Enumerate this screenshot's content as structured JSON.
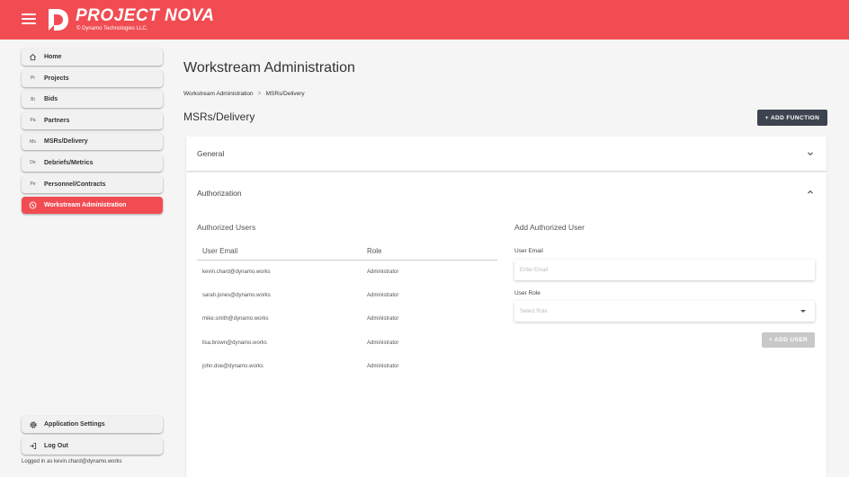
{
  "app": {
    "brand": "PROJECT NOVA",
    "copyright": "© Dynamo Technologies LLC.",
    "accent": "#f14c52"
  },
  "sidebar": {
    "items": [
      {
        "label": "Home",
        "abbr": "",
        "icon": "home-icon"
      },
      {
        "label": "Projects",
        "abbr": "Pr"
      },
      {
        "label": "Bids",
        "abbr": "Bi"
      },
      {
        "label": "Partners",
        "abbr": "Pa"
      },
      {
        "label": "MSRs/Delivery",
        "abbr": "Ms"
      },
      {
        "label": "Debriefs/Metrics",
        "abbr": "De"
      },
      {
        "label": "Personnel/Contracts",
        "abbr": "Pe"
      },
      {
        "label": "Workstream Administration",
        "abbr": "",
        "icon": "workstream-icon",
        "active": true
      }
    ],
    "bottom": [
      {
        "label": "Application Settings",
        "icon": "gear-icon"
      },
      {
        "label": "Log Out",
        "icon": "logout-icon"
      }
    ],
    "logged_in": "Logged in as kevin.chard@dynamo.works"
  },
  "page": {
    "title": "Workstream Administration",
    "breadcrumb": [
      "Workstream Administration",
      "MSRs/Delivery"
    ],
    "breadcrumb_sep": ">",
    "section_title": "MSRs/Delivery",
    "add_function": "+ ADD FUNCTION"
  },
  "panels": {
    "general": {
      "title": "General",
      "expanded": false
    },
    "authorization": {
      "title": "Authorization",
      "expanded": true
    }
  },
  "authorized_users": {
    "title": "Authorized Users",
    "columns": [
      "User Email",
      "Role"
    ],
    "rows": [
      {
        "email": "kevin.chard@dynamo.works",
        "role": "Administrator"
      },
      {
        "email": "sarah.jones@dynamo.works",
        "role": "Administrator"
      },
      {
        "email": "mike.smith@dynamo.works",
        "role": "Administrator"
      },
      {
        "email": "lisa.brown@dynamo.works",
        "role": "Administrator"
      },
      {
        "email": "john.doe@dynamo.works",
        "role": "Administrator"
      }
    ]
  },
  "add_user": {
    "title": "Add Authorized User",
    "email_label": "User Email",
    "email_placeholder": "Enter Email",
    "role_label": "User Role",
    "role_placeholder": "Select Role",
    "button": "+ ADD USER"
  }
}
